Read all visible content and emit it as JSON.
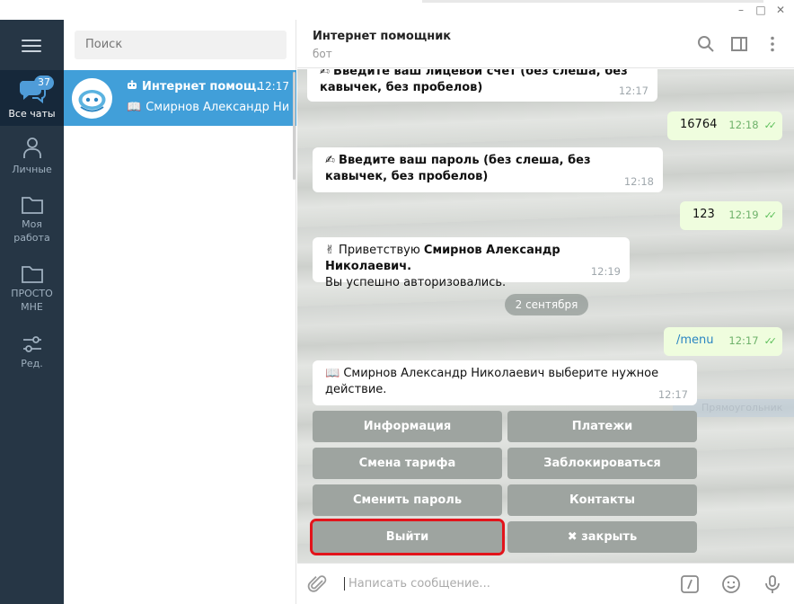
{
  "window": {
    "minimize": "–",
    "maximize": "□",
    "close": "✕"
  },
  "rail": {
    "items": [
      {
        "label": "Все чаты",
        "badge": "37",
        "icon": "chat-bubbles-icon"
      },
      {
        "label": "Личные",
        "icon": "person-icon"
      },
      {
        "label_line1": "Моя",
        "label_line2": "работа",
        "icon": "folder-icon"
      },
      {
        "label_line1": "ПРОСТО",
        "label_line2": "МНЕ",
        "icon": "folder-icon"
      },
      {
        "label": "Ред.",
        "icon": "sliders-icon"
      }
    ]
  },
  "search": {
    "placeholder": "Поиск"
  },
  "chat": {
    "title": "Интернет помощ...",
    "time": "12:17",
    "preview": "Смирнов Александр Ни...",
    "bot_icon": "bot-icon",
    "preview_icon": "book-icon"
  },
  "header": {
    "title": "Интернет помощник",
    "subtitle": "бот"
  },
  "messages": [
    {
      "dir": "in",
      "icon": "✍",
      "text": "Введите ваш лицевой счет (без слеша, без кавычек, без пробелов)",
      "time": "12:17"
    },
    {
      "dir": "out",
      "text": "16764",
      "time": "12:18"
    },
    {
      "dir": "in",
      "icon": "✍",
      "text": "Введите ваш пароль (без слеша, без кавычек, без пробелов)",
      "time": "12:18"
    },
    {
      "dir": "out",
      "text": "123",
      "time": "12:19"
    },
    {
      "dir": "in",
      "icon": "✌",
      "text_pre": "Приветствую ",
      "text_bold": "Смирнов Александр Николаевич.",
      "text_post": "Вы успешно авторизовались.",
      "time": "12:19"
    },
    {
      "dir": "out",
      "text": "/menu",
      "time": "12:17"
    },
    {
      "dir": "in",
      "icon": "📖",
      "text": "Смирнов Александр Николаевич выберите нужное действие.",
      "time": "12:17"
    }
  ],
  "date_separator": "2 сентября",
  "ghost_label": "Прямоугольник",
  "keyboard": [
    [
      "Информация",
      "Платежи"
    ],
    [
      "Смена тарифа",
      "Заблокироваться"
    ],
    [
      "Сменить пароль",
      "Контакты"
    ],
    [
      "Выйти",
      "✖ закрыть"
    ]
  ],
  "composer": {
    "placeholder": "Написать сообщение..."
  }
}
